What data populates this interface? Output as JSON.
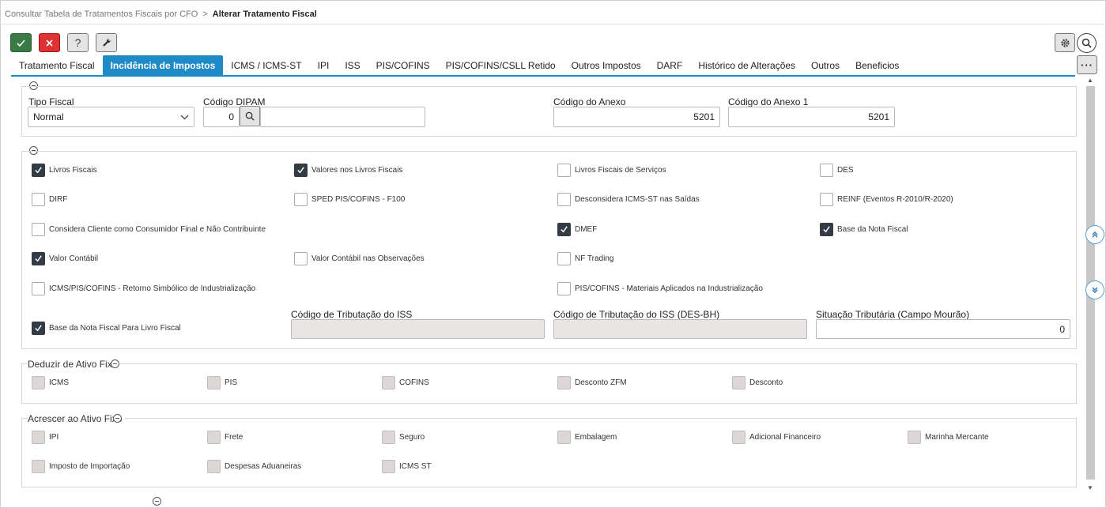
{
  "breadcrumb": {
    "parent": "Consultar Tabela de Tratamentos Fiscais por CFO",
    "separator": ">",
    "current": "Alterar Tratamento Fiscal"
  },
  "toolbar": {
    "help_label": "?"
  },
  "tabs": [
    "Tratamento Fiscal",
    "Incidência de Impostos",
    "ICMS / ICMS-ST",
    "IPI",
    "ISS",
    "PIS/COFINS",
    "PIS/COFINS/CSLL Retido",
    "Outros Impostos",
    "DARF",
    "Histórico de Alterações",
    "Outros",
    "Beneficios"
  ],
  "active_tab": "Incidência de Impostos",
  "more_label": "···",
  "general": {
    "tipo_fiscal_label": "Tipo Fiscal",
    "tipo_fiscal_value": "Normal",
    "codigo_dipam_label": "Código DIPAM",
    "codigo_dipam_value": "0",
    "codigo_anexo_label": "Código do Anexo",
    "codigo_anexo_value": "5201",
    "codigo_anexo1_label": "Código do Anexo 1",
    "codigo_anexo1_value": "5201"
  },
  "options": {
    "livros_fiscais": {
      "label": "Livros Fiscais",
      "checked": true
    },
    "valores_livros": {
      "label": "Valores nos Livros Fiscais",
      "checked": true
    },
    "livros_servicos": {
      "label": "Livros Fiscais de Serviços",
      "checked": false
    },
    "des": {
      "label": "DES",
      "checked": false
    },
    "dirf": {
      "label": "DIRF",
      "checked": false
    },
    "sped": {
      "label": "SPED PIS/COFINS - F100",
      "checked": false
    },
    "desconsidera": {
      "label": "Desconsidera ICMS-ST nas Saídas",
      "checked": false
    },
    "reinf": {
      "label": "REINF (Eventos R-2010/R-2020)",
      "checked": false
    },
    "consumidor_final": {
      "label": "Considera Cliente como Consumidor Final e Não Contribuinte",
      "checked": false
    },
    "dmef": {
      "label": "DMEF",
      "checked": true
    },
    "base_nota": {
      "label": "Base da Nota Fiscal",
      "checked": true
    },
    "valor_contabil": {
      "label": "Valor Contábil",
      "checked": true
    },
    "valor_contabil_obs": {
      "label": "Valor Contábil nas Observações",
      "checked": false
    },
    "nf_trading": {
      "label": "NF Trading",
      "checked": false
    },
    "retorno_simbolico": {
      "label": "ICMS/PIS/COFINS - Retorno Simbólico de Industrialização",
      "checked": false
    },
    "materiais_aplicados": {
      "label": "PIS/COFINS - Materiais Aplicados na Industrialização",
      "checked": false
    },
    "base_nota_livro": {
      "label": "Base da Nota Fiscal Para Livro Fiscal",
      "checked": true
    },
    "cod_trib_iss_label": "Código de Tributação do ISS",
    "cod_trib_iss_value": "",
    "cod_trib_iss_bh_label": "Código de Tributação do ISS (DES-BH)",
    "cod_trib_iss_bh_value": "",
    "situacao_label": "Situação Tributária (Campo Mourão)",
    "situacao_value": "0"
  },
  "deduzir": {
    "title": "Deduzir de Ativo Fixo",
    "items": [
      "ICMS",
      "PIS",
      "COFINS",
      "Desconto ZFM",
      "Desconto"
    ]
  },
  "acrescer": {
    "title": "Acrescer ao Ativo Fixo",
    "items": [
      "IPI",
      "Frete",
      "Seguro",
      "Embalagem",
      "Adicional Financeiro",
      "Marinha Mercante",
      "Imposto de Importação",
      "Despesas Aduaneiras",
      "ICMS ST"
    ]
  },
  "colors": {
    "accent": "#1e8ac6",
    "ok": "#3a7a45",
    "cancel": "#dd3333",
    "checked": "#333b45"
  }
}
